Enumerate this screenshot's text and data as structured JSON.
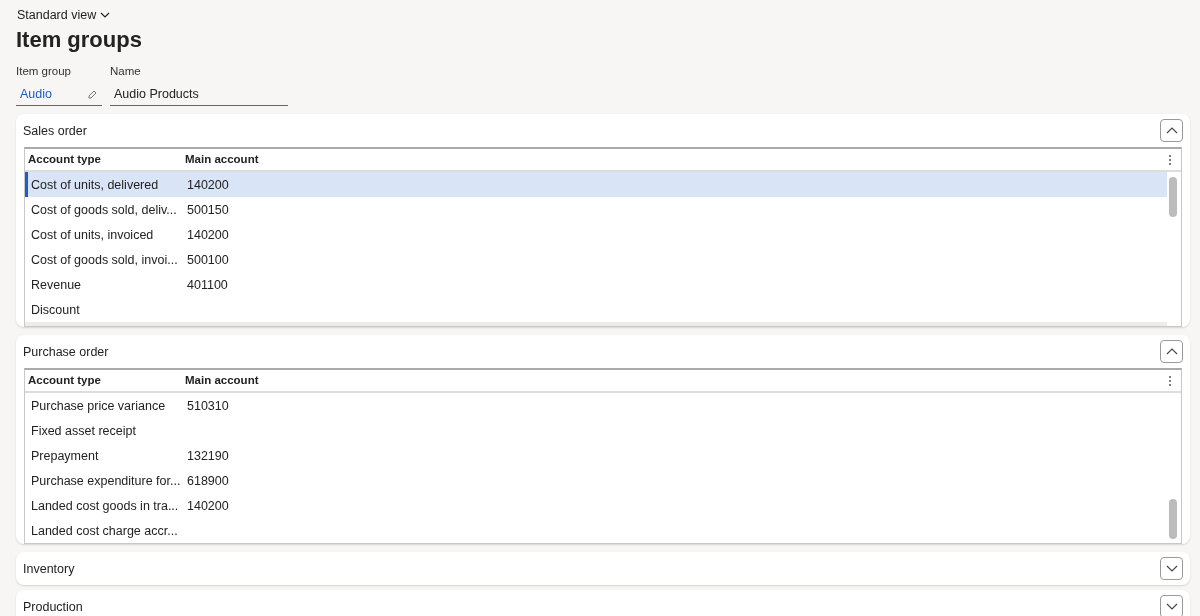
{
  "view_selector": "Standard view",
  "title": "Item groups",
  "fields": [
    {
      "label": "Item group",
      "value": "Audio",
      "kind": "link"
    },
    {
      "label": "Name",
      "value": "Audio Products",
      "kind": "text"
    }
  ],
  "sections": [
    {
      "title": "Sales order",
      "expanded": true,
      "columns": [
        "Account type",
        "Main account"
      ],
      "rows": [
        {
          "account_type": "Cost of units, delivered",
          "main_account": "140200",
          "selected": true
        },
        {
          "account_type": "Cost of goods sold, deliv...",
          "main_account": "500150",
          "selected": false
        },
        {
          "account_type": "Cost of units, invoiced",
          "main_account": "140200",
          "selected": false
        },
        {
          "account_type": "Cost of goods sold, invoi...",
          "main_account": "500100",
          "selected": false
        },
        {
          "account_type": "Revenue",
          "main_account": "401100",
          "selected": false
        },
        {
          "account_type": "Discount",
          "main_account": "",
          "selected": false
        }
      ]
    },
    {
      "title": "Purchase order",
      "expanded": true,
      "columns": [
        "Account type",
        "Main account"
      ],
      "rows": [
        {
          "account_type": "Purchase price variance",
          "main_account": "510310",
          "selected": false
        },
        {
          "account_type": "Fixed asset receipt",
          "main_account": "",
          "selected": false
        },
        {
          "account_type": "Prepayment",
          "main_account": "132190",
          "selected": false
        },
        {
          "account_type": "Purchase expenditure for...",
          "main_account": "618900",
          "selected": false
        },
        {
          "account_type": "Landed cost goods in tra...",
          "main_account": "140200",
          "selected": false
        },
        {
          "account_type": "Landed cost charge accr...",
          "main_account": "",
          "selected": false
        }
      ]
    },
    {
      "title": "Inventory",
      "expanded": false
    },
    {
      "title": "Production",
      "expanded": false
    }
  ]
}
